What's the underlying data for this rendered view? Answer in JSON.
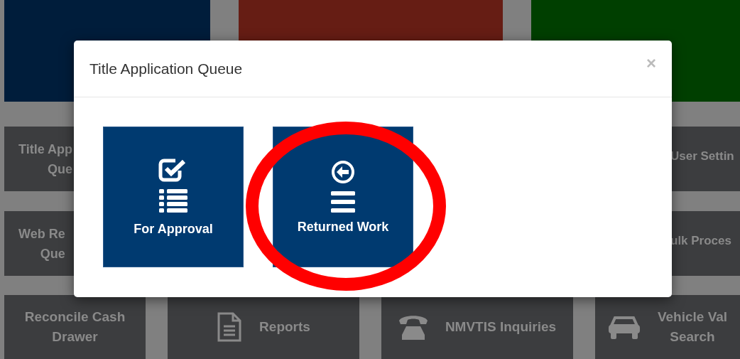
{
  "background": {
    "top_tiles": [
      {
        "color": "#001d3b"
      },
      {
        "color": "#661d14"
      },
      {
        "color": "#003f00"
      }
    ],
    "left_tiles": [
      {
        "lines": [
          "Title App",
          "Que"
        ]
      },
      {
        "lines": [
          "Web Re",
          "Que"
        ]
      }
    ],
    "right_tiles": [
      {
        "lines": [
          "User Settin"
        ]
      },
      {
        "lines": [
          "ulk Proces"
        ]
      }
    ],
    "bottom_tiles": [
      {
        "lines": [
          "Reconcile Cash",
          "Drawer"
        ]
      },
      {
        "lines": [
          "Reports"
        ]
      },
      {
        "lines": [
          "NMVTIS Inquiries"
        ]
      },
      {
        "lines": [
          "Vehicle Val",
          "Search"
        ]
      }
    ]
  },
  "modal": {
    "title": "Title Application Queue",
    "close": "×",
    "options": [
      {
        "label": "For Approval",
        "circled": false
      },
      {
        "label": "Returned Work",
        "circled": true
      }
    ]
  }
}
